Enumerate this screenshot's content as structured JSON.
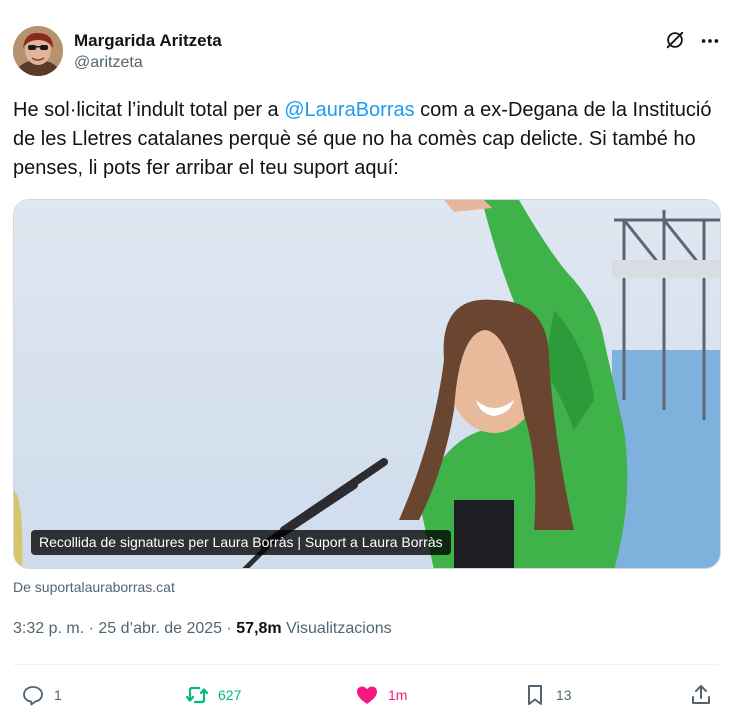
{
  "author": {
    "display_name": "Margarida Aritzeta",
    "handle": "@aritzeta"
  },
  "header_icons": {
    "grok": "grok-icon",
    "more": "more-icon"
  },
  "tweet": {
    "text_before": "He sol·licitat l’indult total per a ",
    "mention": "@LauraBorras",
    "text_after": "  com a ex-Degana de la Institució de les Lletres catalanes perquè sé que no ha comès cap delicte. Si també ho penses, li pots fer arribar el teu suport aquí:"
  },
  "card": {
    "title": "Recollida de signatures per Laura Borràs | Suport a Laura Borràs",
    "source": "De suportalauraborras.cat"
  },
  "meta": {
    "time": "3:32 p. m.",
    "separator": " · ",
    "date": "25 d’abr. de 2025",
    "views_count": "57,8m",
    "views_label": " Visualitzacions"
  },
  "actions": {
    "replies": "1",
    "retweets": "627",
    "likes": "1m",
    "bookmarks": "13"
  },
  "colors": {
    "accent": "#1d9bf0",
    "retweet": "#00ba7c",
    "like": "#f91880",
    "secondary_text": "#536471"
  }
}
